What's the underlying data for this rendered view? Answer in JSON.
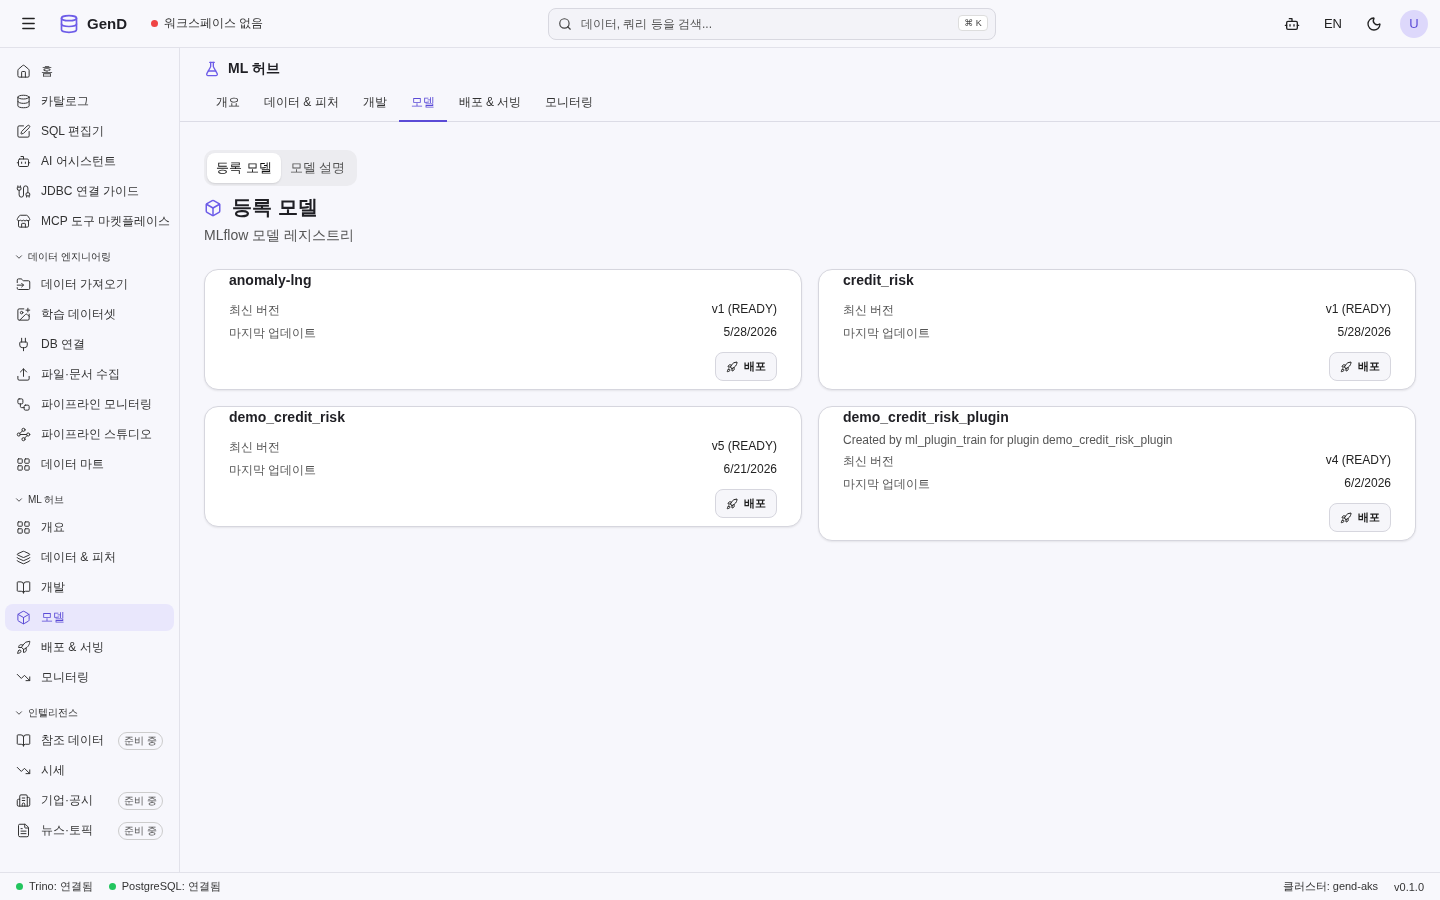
{
  "header": {
    "brand": "GenD",
    "workspace": {
      "label": "워크스페이스 없음",
      "color": "#ef4444"
    },
    "search": {
      "placeholder": "데이터, 쿼리 등을 검색...",
      "shortcut": "⌘ K"
    },
    "language": "EN",
    "avatar": "U"
  },
  "sidebar": {
    "items": [
      {
        "label": "홈",
        "selected": false
      },
      {
        "label": "카탈로그",
        "selected": false
      },
      {
        "label": "SQL 편집기",
        "selected": false
      },
      {
        "label": "AI 어시스턴트",
        "selected": false
      },
      {
        "label": "JDBC 연결 가이드",
        "selected": false
      },
      {
        "label": "MCP 도구 마켓플레이스",
        "selected": false
      }
    ],
    "sections": [
      {
        "title": "데이터 엔지니어링",
        "expanded": true,
        "items": [
          {
            "label": "데이터 가져오기",
            "selected": false
          },
          {
            "label": "학습 데이터셋",
            "selected": false
          },
          {
            "label": "DB 연결",
            "selected": false
          },
          {
            "label": "파일·문서 수집",
            "selected": false
          },
          {
            "label": "파이프라인 모니터링",
            "selected": false
          },
          {
            "label": "파이프라인 스튜디오",
            "selected": false
          },
          {
            "label": "데이터 마트",
            "selected": false
          }
        ]
      },
      {
        "title": "ML 허브",
        "expanded": true,
        "items": [
          {
            "label": "개요",
            "selected": false
          },
          {
            "label": "데이터 & 피처",
            "selected": false
          },
          {
            "label": "개발",
            "selected": false
          },
          {
            "label": "모델",
            "selected": true
          },
          {
            "label": "배포 & 서빙",
            "selected": false
          },
          {
            "label": "모니터링",
            "selected": false
          }
        ]
      },
      {
        "title": "인텔리전스",
        "expanded": true,
        "items": [
          {
            "label": "참조 데이터",
            "selected": false,
            "badge": "준비 중"
          },
          {
            "label": "시세",
            "selected": false
          },
          {
            "label": "기업·공시",
            "selected": false,
            "badge": "준비 중"
          },
          {
            "label": "뉴스·토픽",
            "selected": false,
            "badge": "준비 중"
          }
        ]
      }
    ]
  },
  "page": {
    "title": "ML 허브",
    "tabs": [
      {
        "label": "개요",
        "selected": false
      },
      {
        "label": "데이터 & 피처",
        "selected": false
      },
      {
        "label": "개발",
        "selected": false
      },
      {
        "label": "모델",
        "selected": true
      },
      {
        "label": "배포 & 서빙",
        "selected": false
      },
      {
        "label": "모니터링",
        "selected": false
      }
    ],
    "segments": [
      {
        "label": "등록 모델",
        "selected": true
      },
      {
        "label": "모델 설명",
        "selected": false
      }
    ],
    "heading": "등록 모델",
    "subtitle": "MLflow 모델 레지스트리",
    "models": [
      {
        "name": "anomaly-lng",
        "rows": [
          {
            "label": "최신 버전",
            "value": "v1 (READY)"
          },
          {
            "label": "마지막 업데이트",
            "value": "5/28/2026"
          }
        ],
        "action": "배포"
      },
      {
        "name": "credit_risk",
        "rows": [
          {
            "label": "최신 버전",
            "value": "v1 (READY)"
          },
          {
            "label": "마지막 업데이트",
            "value": "5/28/2026"
          }
        ],
        "action": "배포"
      },
      {
        "name": "demo_credit_risk",
        "rows": [
          {
            "label": "최신 버전",
            "value": "v5 (READY)"
          },
          {
            "label": "마지막 업데이트",
            "value": "6/21/2026"
          }
        ],
        "action": "배포"
      },
      {
        "name": "demo_credit_risk_plugin",
        "description": "Created by ml_plugin_train for plugin demo_credit_risk_plugin",
        "rows": [
          {
            "label": "최신 버전",
            "value": "v4 (READY)"
          },
          {
            "label": "마지막 업데이트",
            "value": "6/2/2026"
          }
        ],
        "action": "배포"
      }
    ]
  },
  "status_bar": {
    "connections": [
      {
        "label": "Trino: 연결됨",
        "color": "#22c55e"
      },
      {
        "label": "PostgreSQL: 연결됨",
        "color": "#22c55e"
      }
    ],
    "cluster": "클러스터: gend-aks",
    "version": "v0.1.0"
  }
}
